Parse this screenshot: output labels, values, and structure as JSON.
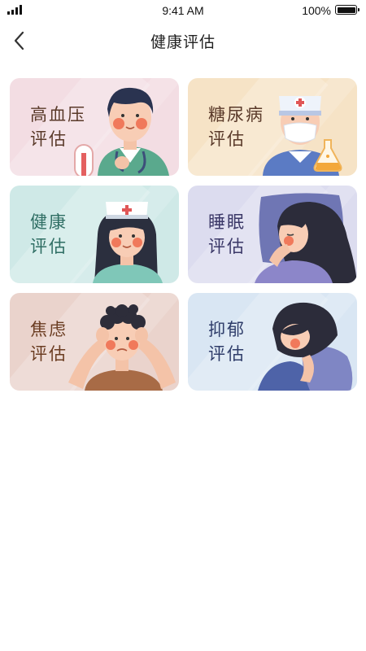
{
  "status_bar": {
    "time": "9:41 AM",
    "battery": "100%"
  },
  "nav": {
    "back_icon": "chevron-left-icon",
    "title": "健康评估"
  },
  "cards": [
    {
      "key": "hypertension",
      "line1": "高血压",
      "line2": "评估",
      "bg": "#f3dde3",
      "text_color": "#5a3a2a"
    },
    {
      "key": "diabetes",
      "line1": "糖尿病",
      "line2": "评估",
      "bg": "#f6e3c6",
      "text_color": "#5a3a2a"
    },
    {
      "key": "health",
      "line1": "健康",
      "line2": "评估",
      "bg": "#cfe9e7",
      "text_color": "#2f6e64"
    },
    {
      "key": "sleep",
      "line1": "睡眠",
      "line2": "评估",
      "bg": "#dcdcef",
      "text_color": "#3b3868"
    },
    {
      "key": "anxiety",
      "line1": "焦虑",
      "line2": "评估",
      "bg": "#ead3cc",
      "text_color": "#6b3d22"
    },
    {
      "key": "depression",
      "line1": "抑郁",
      "line2": "评估",
      "bg": "#d9e6f3",
      "text_color": "#2f3d6a"
    }
  ]
}
